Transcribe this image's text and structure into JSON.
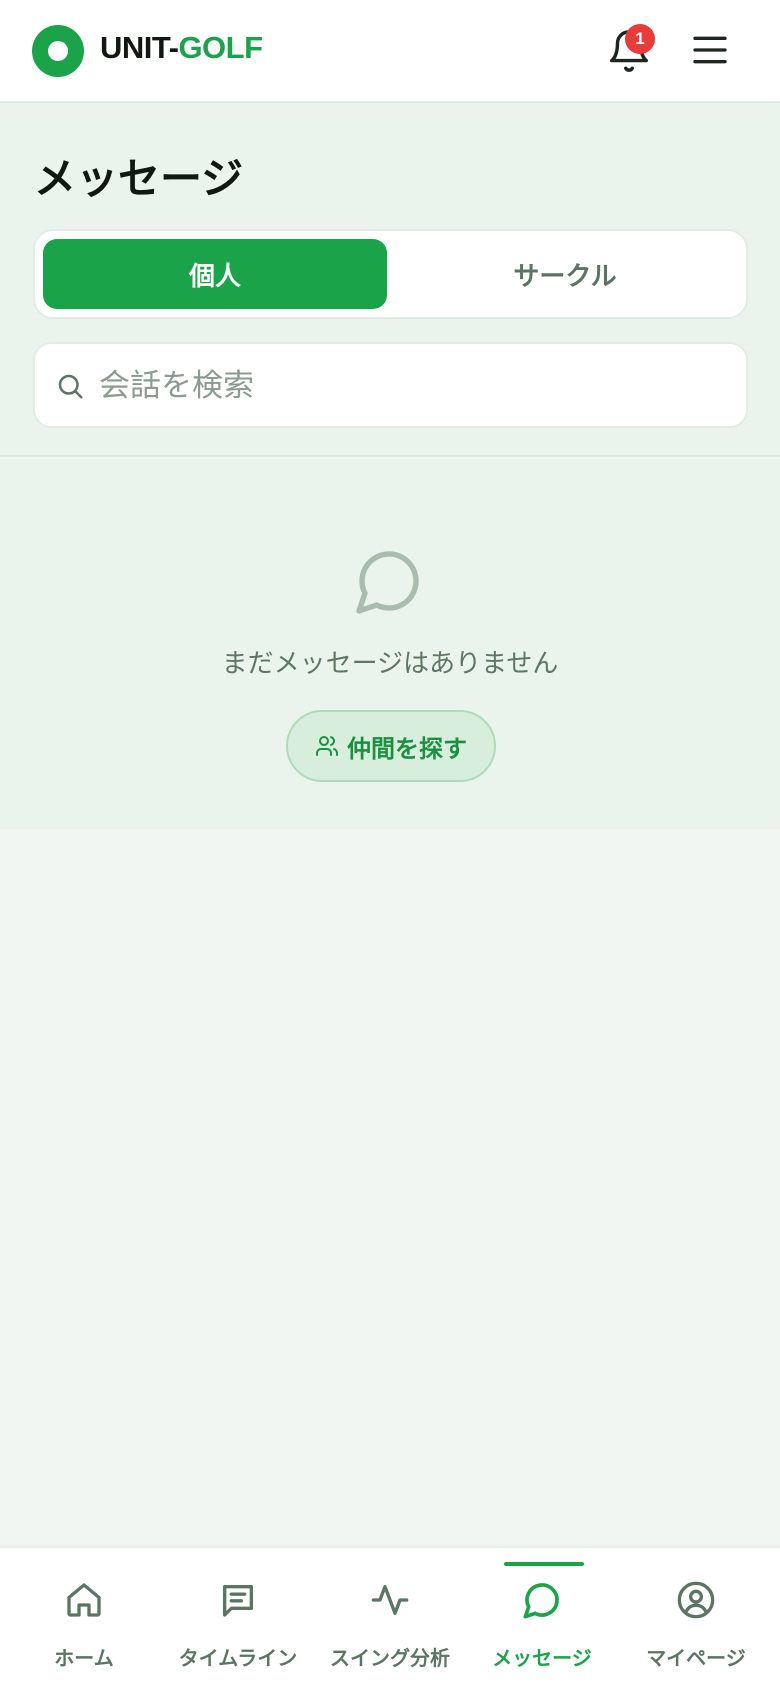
{
  "header": {
    "logo_unit": "UNIT-",
    "logo_golf": "GOLF",
    "notification_count": "1",
    "bell_icon": "bell-icon",
    "menu_icon": "hamburger-menu-icon"
  },
  "page": {
    "title": "メッセージ"
  },
  "tabs": [
    {
      "label": "個人",
      "active": true
    },
    {
      "label": "サークル",
      "active": false
    }
  ],
  "search": {
    "placeholder": "会話を検索",
    "value": "",
    "icon": "search-icon"
  },
  "empty_state": {
    "icon": "chat-bubble-icon",
    "message": "まだメッセージはありません",
    "button_label": "仲間を探す",
    "button_icon": "users-icon"
  },
  "bottom_nav": [
    {
      "label": "ホーム",
      "icon": "home-icon",
      "active": false
    },
    {
      "label": "タイムライン",
      "icon": "timeline-icon",
      "active": false
    },
    {
      "label": "スイング分析",
      "icon": "activity-icon",
      "active": false
    },
    {
      "label": "メッセージ",
      "icon": "chat-bubble-icon",
      "active": true
    },
    {
      "label": "マイページ",
      "icon": "user-circle-icon",
      "active": false
    }
  ],
  "colors": {
    "brand": "#1ba34a",
    "badge": "#e93b3b",
    "muted_text": "#5b7563",
    "background": "#ebf3ed"
  }
}
